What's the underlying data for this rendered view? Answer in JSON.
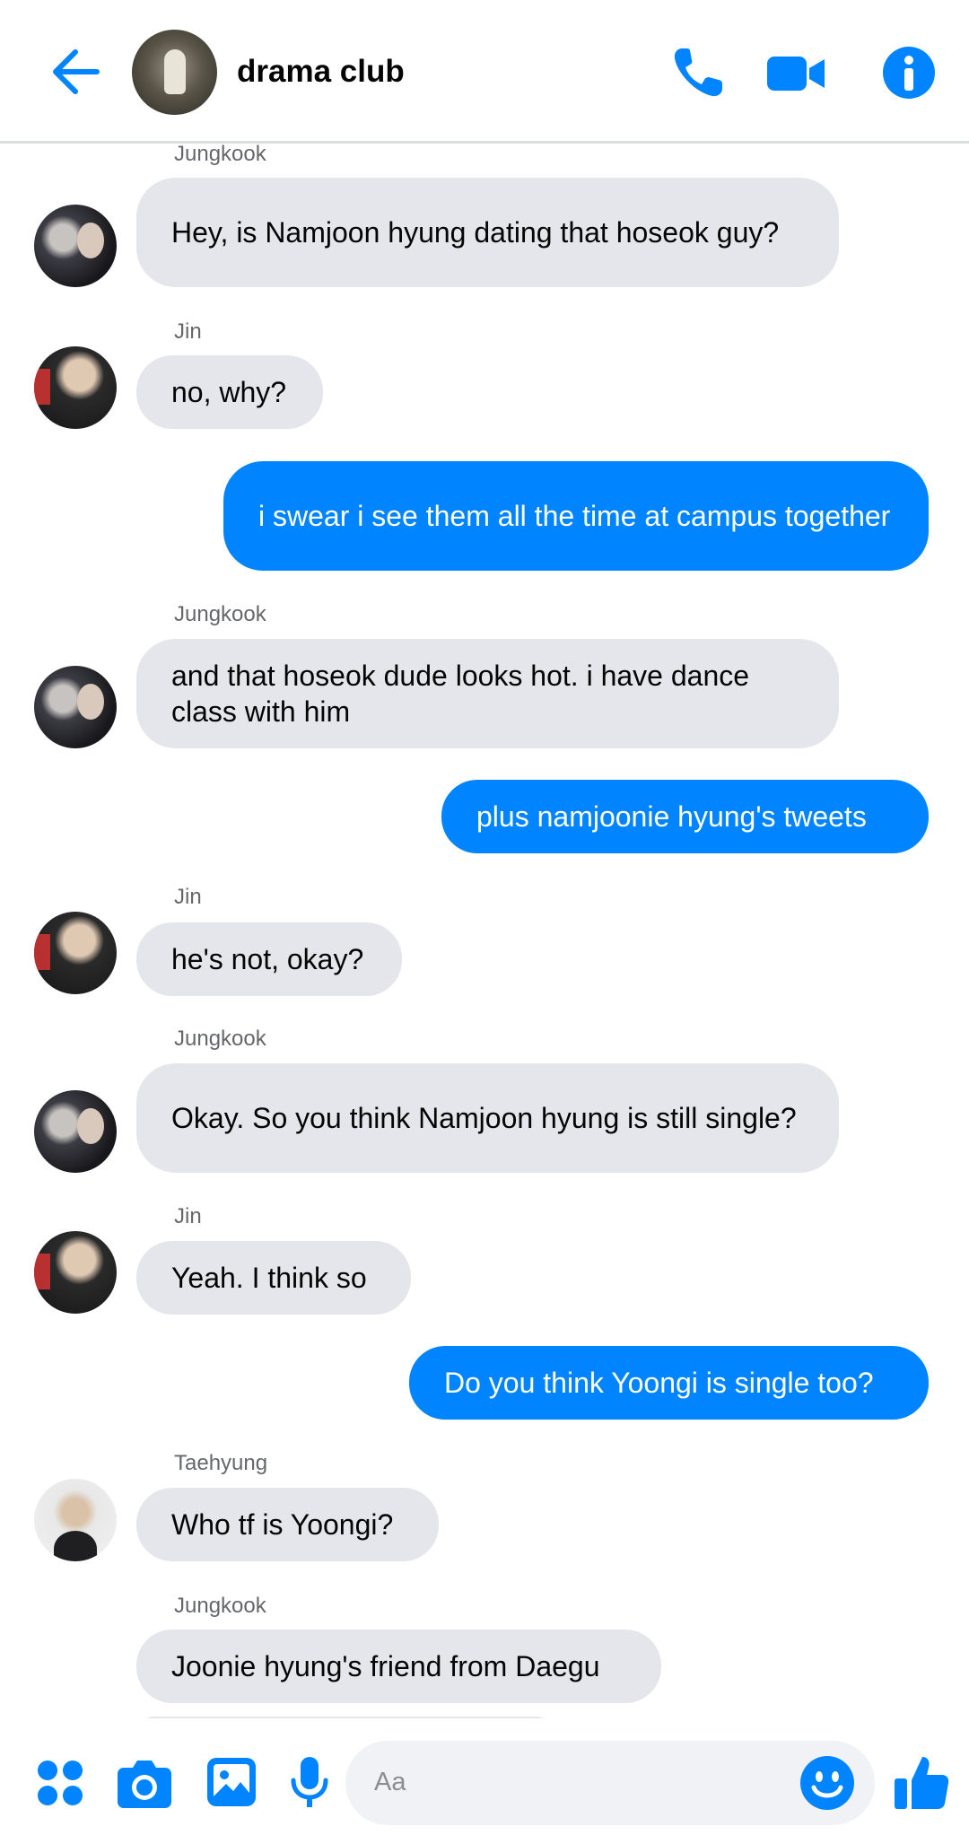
{
  "header": {
    "title": "drama club",
    "back_icon": "arrow-left-icon",
    "call_icon": "phone-icon",
    "video_icon": "video-camera-icon",
    "info_icon": "info-icon",
    "accent_color": "#0084ff"
  },
  "messages": [
    {
      "sender": "Jungkook",
      "text": "Hey, is Namjoon hyung dating that hoseok guy?",
      "direction": "incoming"
    },
    {
      "sender": "Jin",
      "text": "no, why?",
      "direction": "incoming"
    },
    {
      "text": "i swear i see them all the time at campus together",
      "direction": "outgoing"
    },
    {
      "sender": "Jungkook",
      "text": "and that hoseok dude looks hot. i have dance class with him",
      "direction": "incoming"
    },
    {
      "text": "plus namjoonie hyung's tweets",
      "direction": "outgoing"
    },
    {
      "sender": "Jin",
      "text": "he's not, okay?",
      "direction": "incoming"
    },
    {
      "sender": "Jungkook",
      "text": "Okay. So you think Namjoon hyung is still single?",
      "direction": "incoming"
    },
    {
      "sender": "Jin",
      "text": "Yeah. I think so",
      "direction": "incoming"
    },
    {
      "text": "Do you think Yoongi is single too?",
      "direction": "outgoing"
    },
    {
      "sender": "Taehyung",
      "text": "Who tf is Yoongi?",
      "direction": "incoming"
    },
    {
      "sender": "Jungkook",
      "text": "Joonie hyung's friend from Daegu",
      "direction": "incoming"
    }
  ],
  "composer": {
    "placeholder": "Aa",
    "menu_icon": "four-dots-icon",
    "camera_icon": "camera-icon",
    "gallery_icon": "image-icon",
    "mic_icon": "microphone-icon",
    "emoji_icon": "smiley-icon",
    "like_icon": "thumbs-up-icon"
  },
  "colors": {
    "incoming_bubble": "#e4e6eb",
    "outgoing_bubble": "#0084ff",
    "sender_name": "#65676b"
  }
}
